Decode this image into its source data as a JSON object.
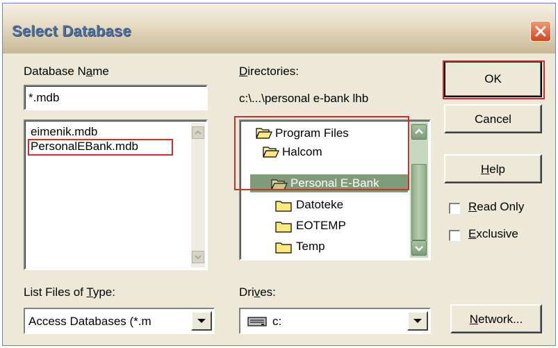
{
  "dialog": {
    "title": "Select Database"
  },
  "database_name": {
    "label": "Database Name",
    "label_pre": "Database N",
    "label_accel": "a",
    "label_post": "me",
    "value": "*.mdb",
    "files": [
      "eimenik.mdb",
      "PersonalEBank.mdb"
    ]
  },
  "directories": {
    "label_accel": "D",
    "label_post": "irectories:",
    "path": "c:\\...\\personal e-bank lhb",
    "items": [
      {
        "label": "Program Files",
        "state": "open"
      },
      {
        "label": "Halcom",
        "state": "open"
      },
      {
        "label": "Personal E-Bank",
        "state": "open-selected"
      },
      {
        "label": "Datoteke",
        "state": "closed"
      },
      {
        "label": "EOTEMP",
        "state": "closed"
      },
      {
        "label": "Temp",
        "state": "closed"
      }
    ]
  },
  "buttons": {
    "ok": "OK",
    "cancel": "Cancel",
    "help_accel": "H",
    "help_post": "elp",
    "network_accel": "N",
    "network_post": "etwork..."
  },
  "options": {
    "read_only_accel": "R",
    "read_only_post": "ead Only",
    "read_only_checked": false,
    "exclusive_accel": "E",
    "exclusive_post": "xclusive",
    "exclusive_checked": false
  },
  "file_type": {
    "label_pre": "List Files of ",
    "label_accel": "T",
    "label_post": "ype:",
    "value": "Access Databases (*.m"
  },
  "drives": {
    "label_pre": "Dri",
    "label_accel": "v",
    "label_post": "es:",
    "value": "c:"
  },
  "colors": {
    "highlight_box": "#d42a2a",
    "selected_bg": "#7e9c78",
    "scroll_green": "#9fb892"
  },
  "icons": [
    "close-icon",
    "folder-open-icon",
    "folder-closed-icon",
    "drive-icon",
    "dropdown-arrow-icon",
    "scroll-up-icon",
    "scroll-down-icon"
  ]
}
